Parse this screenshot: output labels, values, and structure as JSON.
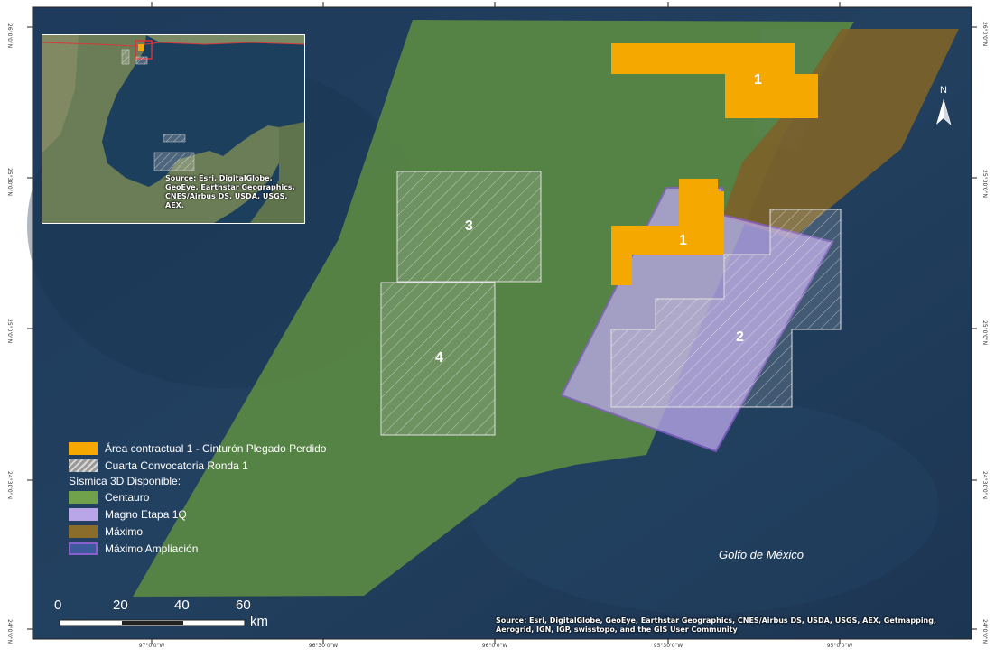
{
  "map": {
    "coords_top_left": "26°0'0\"N",
    "coords_right": [
      "26°0'0\"N",
      "25°30'0\"N",
      "25°0'0\"N",
      "24°30'0\"N",
      "24°0'0\"N"
    ],
    "coords_left": [
      "25°30'0\"N",
      "25°0'0\"N",
      "24°30'0\"N",
      "24°0'0\"N"
    ],
    "coords_bottom": [
      "97°0'0\"W",
      "96°30'0\"W",
      "96°0'0\"W",
      "95°30'0\"W",
      "95°0'0\"W"
    ],
    "area_labels": [
      "1",
      "1",
      "2",
      "3",
      "4"
    ],
    "gulf_label": "Golfo de México",
    "north_letter": "N",
    "attribution": "Source: Esri, DigitalGlobe, GeoEye, Earthstar Geographics, CNES/Airbus DS, USDA, USGS, AEX, Getmapping, Aerogrid, IGN, IGP, swisstopo, and the GIS User Community",
    "inset_attribution": "Source: Esri, DigitalGlobe, GeoEye, Earthstar Geographics, CNES/Airbus DS, USDA, USGS, AEX.",
    "scale": {
      "ticks": [
        "0",
        "20",
        "40",
        "60"
      ],
      "unit": "km"
    }
  },
  "legend": {
    "items": [
      {
        "label": "Área contractual 1 - Cinturón Plegado Perdido",
        "color": "#f5a800"
      },
      {
        "label": "Cuarta Convocatoria Ronda 1",
        "color": "#c8c8c8"
      }
    ],
    "seismic_heading": "Sísmica 3D Disponible:",
    "seismic_items": [
      {
        "label": "Centauro",
        "color": "#6fa24a"
      },
      {
        "label": "Magno Etapa 1Q",
        "color": "#b9a6e8"
      },
      {
        "label": "Máximo",
        "color": "#8a6d2a"
      },
      {
        "label": "Máximo Ampliación",
        "color": "#3d5a9c"
      }
    ]
  }
}
